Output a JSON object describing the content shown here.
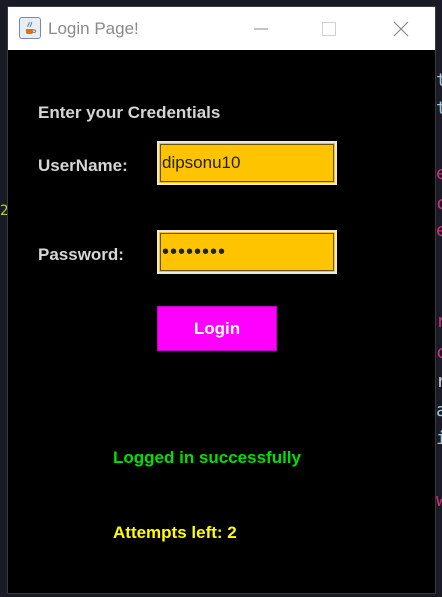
{
  "window": {
    "title": "Login Page!",
    "app_icon": "java-icon",
    "controls": [
      "minimize-icon",
      "maximize-icon",
      "close-icon"
    ]
  },
  "form": {
    "header": "Enter your Credentials",
    "username_label": "UserName:",
    "username_value": "dipsonu10",
    "password_label": "Password:",
    "password_masked": "••••••••",
    "login_label": "Login"
  },
  "status": {
    "message": "Logged in successfully",
    "attempts": "Attempts left: 2"
  },
  "colors": {
    "window_bg": "#000000",
    "field_bg": "#ffc400",
    "button_bg": "#ff00ff",
    "success_text": "#00e000",
    "attempts_text": "#ffff00",
    "label_text": "#d6d6d6"
  }
}
